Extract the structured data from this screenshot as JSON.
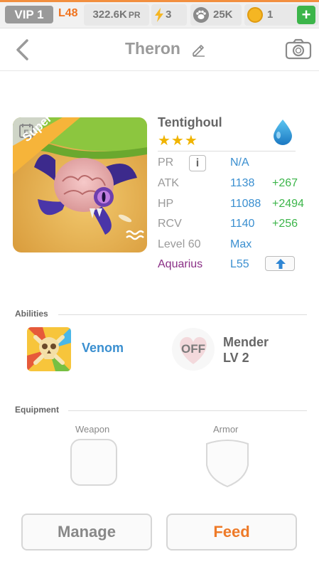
{
  "status_bar": {
    "vip": "VIP 1",
    "level": "L48",
    "pr_value": "322.6K",
    "pr_unit": "PR",
    "energy": "3",
    "paw_count": "25K",
    "coins": "1",
    "add_label": "+",
    "accent_color": "#f28f3f"
  },
  "header": {
    "title": "Theron",
    "back_icon": "chevron-left-icon",
    "edit_icon": "pencil-icon",
    "camera_icon": "camera-icon"
  },
  "monster": {
    "name": "Tentighoul",
    "stars": "★★★",
    "star_count": 3,
    "rarity_badge": "Super",
    "element_icon": "water-drop-icon",
    "stats": {
      "pr_label": "PR",
      "pr_info": "i",
      "pr_value": "N/A",
      "atk_label": "ATK",
      "atk_value": "1138",
      "atk_bonus": "+267",
      "hp_label": "HP",
      "hp_value": "11088",
      "hp_bonus": "+2494",
      "rcv_label": "RCV",
      "rcv_value": "1140",
      "rcv_bonus": "+256",
      "level_label": "Level 60",
      "level_value": "Max",
      "sign_label": "Aquarius",
      "sign_value": "L55"
    }
  },
  "abilities": {
    "title": "Abilities",
    "items": [
      {
        "name": "Venom",
        "icon": "skull-icon"
      },
      {
        "name": "Mender",
        "level": "LV 2",
        "state": "OFF",
        "icon": "heart-icon"
      }
    ]
  },
  "equipment": {
    "title": "Equipment",
    "weapon_label": "Weapon",
    "armor_label": "Armor"
  },
  "actions": {
    "manage": "Manage",
    "feed": "Feed"
  },
  "colors": {
    "blue_value": "#3a8fd0",
    "green_bonus": "#3cb54a",
    "orange_feed": "#ee7a28",
    "purple_sign": "#8a2f86"
  }
}
